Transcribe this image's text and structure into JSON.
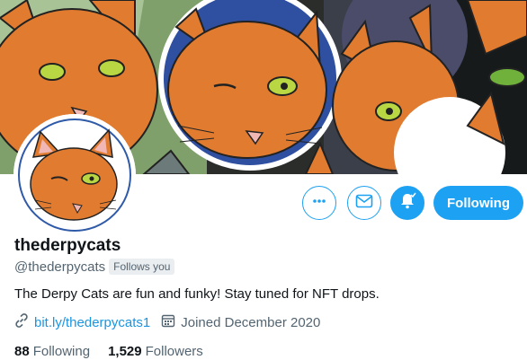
{
  "profile": {
    "display_name": "thederpycats",
    "handle": "@thederpycats",
    "follows_you_badge": "Follows you",
    "bio": "The Derpy Cats are fun and funky! Stay tuned for NFT drops.",
    "link": "bit.ly/thederpycats1",
    "joined": "Joined December 2020"
  },
  "actions": {
    "follow_label": "Following"
  },
  "stats": {
    "following_count": "88",
    "following_label": "Following",
    "followers_count": "1,529",
    "followers_label": "Followers"
  },
  "icons": {
    "more": "more-horizontal-icon",
    "message": "envelope-icon",
    "notifications": "bell-icon",
    "link": "link-icon",
    "calendar": "calendar-icon"
  },
  "colors": {
    "accent": "#1da1f2",
    "link": "#1b95e0",
    "cat_orange": "#e6751c",
    "text_primary": "#0f1419",
    "text_secondary": "#536471"
  }
}
